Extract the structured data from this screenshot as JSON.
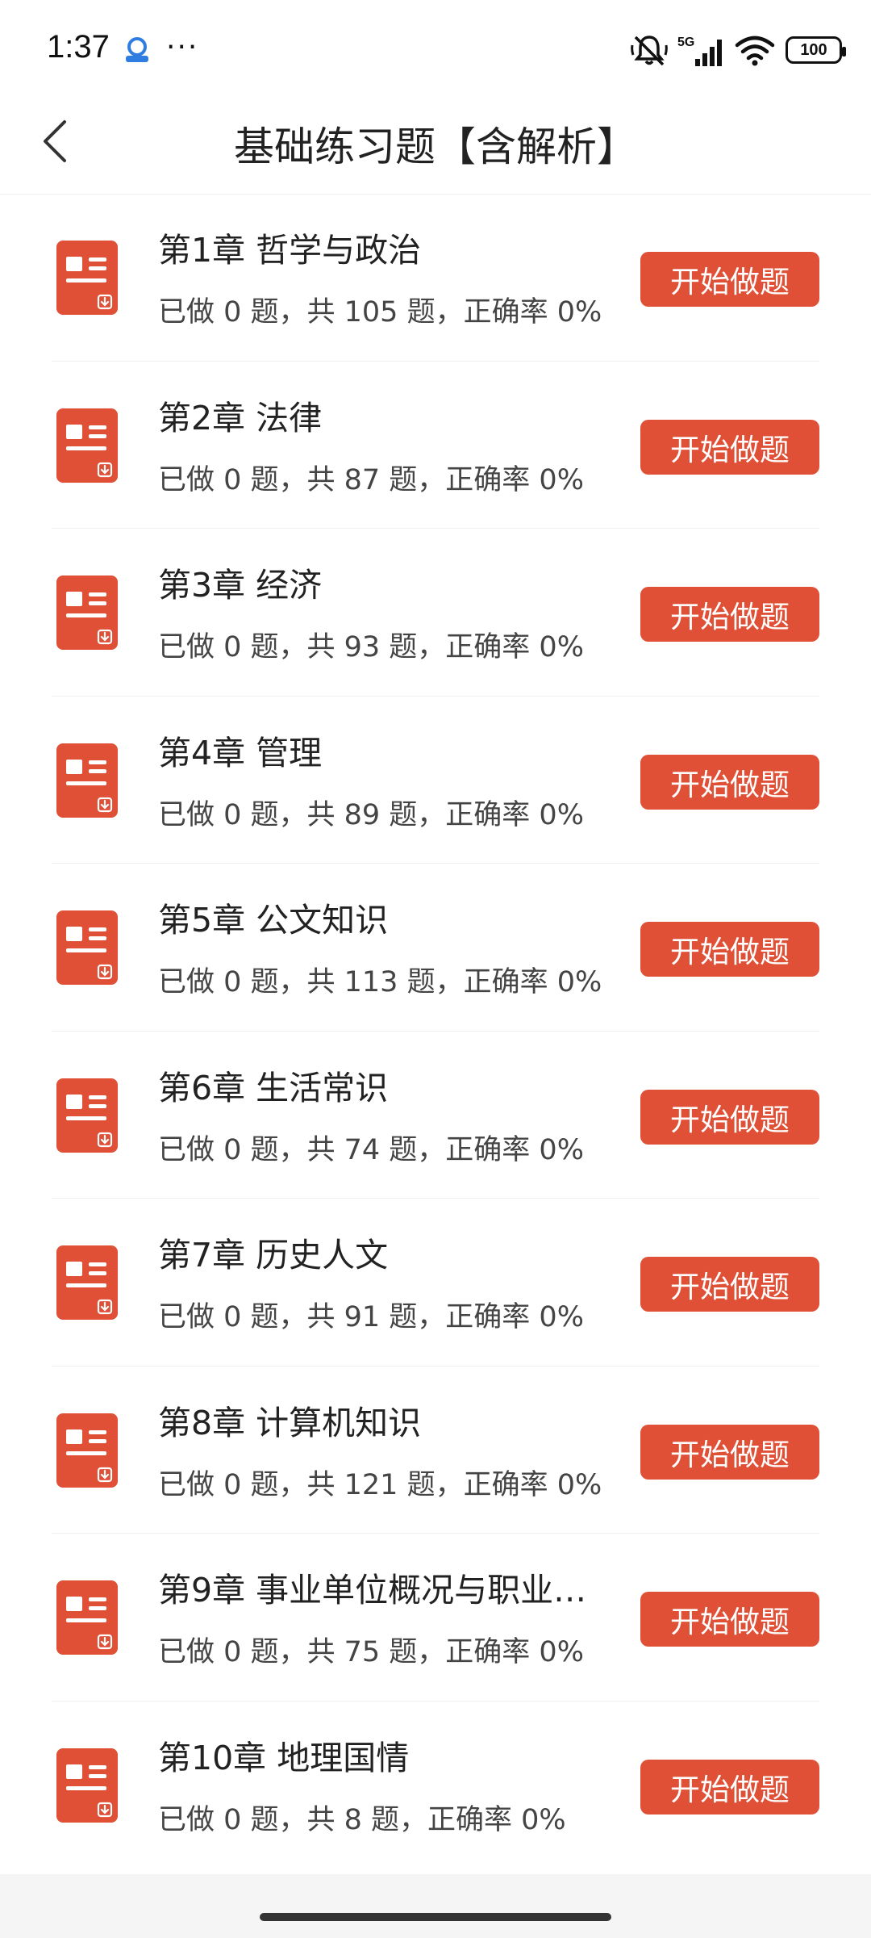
{
  "status_bar": {
    "time": "1:37",
    "dots": "···",
    "network": "5G",
    "battery": "100"
  },
  "header": {
    "title": "基础练习题【含解析】"
  },
  "actions": {
    "start_label": "开始做题"
  },
  "chapters": [
    {
      "title": "第1章 哲学与政治",
      "stats": "已做 0 题，共 105 题，正确率 0%"
    },
    {
      "title": "第2章 法律",
      "stats": "已做 0 题，共 87 题，正确率 0%"
    },
    {
      "title": "第3章 经济",
      "stats": "已做 0 题，共 93 题，正确率 0%"
    },
    {
      "title": "第4章 管理",
      "stats": "已做 0 题，共 89 题，正确率 0%"
    },
    {
      "title": "第5章 公文知识",
      "stats": "已做 0 题，共 113 题，正确率 0%"
    },
    {
      "title": "第6章 生活常识",
      "stats": "已做 0 题，共 74 题，正确率 0%"
    },
    {
      "title": "第7章 历史人文",
      "stats": "已做 0 题，共 91 题，正确率 0%"
    },
    {
      "title": "第8章 计算机知识",
      "stats": "已做 0 题，共 121 题，正确率 0%"
    },
    {
      "title": "第9章 事业单位概况与职业…",
      "stats": "已做 0 题，共 75 题，正确率 0%"
    },
    {
      "title": "第10章 地理国情",
      "stats": "已做 0 题，共 8 题，正确率 0%"
    }
  ],
  "icons": {
    "back": "chevron-left-icon",
    "chapter": "document-icon",
    "mute": "bell-off-icon",
    "signal": "signal-icon",
    "wifi": "wifi-icon",
    "battery": "battery-icon"
  },
  "colors": {
    "accent": "#e05036",
    "text": "#222222",
    "subtext": "#444444",
    "divider": "#efefef"
  }
}
